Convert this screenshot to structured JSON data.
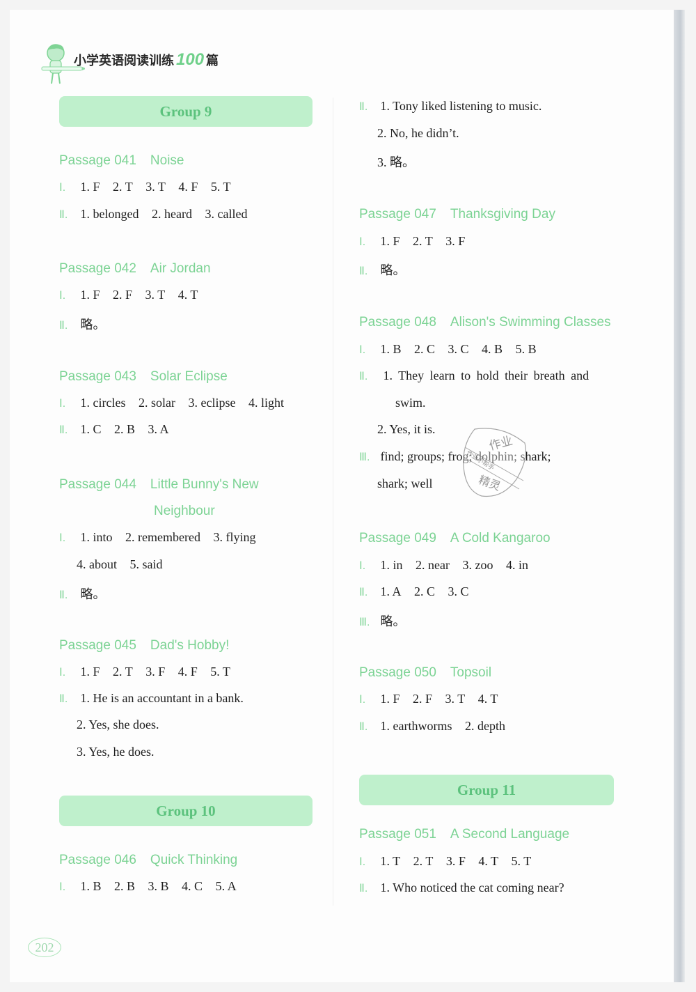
{
  "header": {
    "title_cn": "小学英语阅读训练",
    "title_num": "100",
    "title_suffix": "篇"
  },
  "page_number": "202",
  "stamp_text": {
    "main_top": "作业",
    "main_bottom": "精灵",
    "side": "作业小帮手"
  },
  "left_column": {
    "group_9": "Group 9",
    "p041": {
      "num": "Passage 041",
      "name": "Noise",
      "I": {
        "label": "Ⅰ.",
        "answers": [
          "1. F",
          "2. T",
          "3. T",
          "4. F",
          "5. T"
        ]
      },
      "II": {
        "label": "Ⅱ.",
        "answers": [
          "1. belonged",
          "2. heard",
          "3. called"
        ]
      }
    },
    "p042": {
      "num": "Passage 042",
      "name": "Air Jordan",
      "I": {
        "label": "Ⅰ.",
        "answers": [
          "1. F",
          "2. F",
          "3. T",
          "4. T"
        ]
      },
      "II": {
        "label": "Ⅱ.",
        "text": "略。"
      }
    },
    "p043": {
      "num": "Passage 043",
      "name": "Solar Eclipse",
      "I": {
        "label": "Ⅰ.",
        "answers": [
          "1. circles",
          "2. solar",
          "3. eclipse",
          "4. light"
        ]
      },
      "II": {
        "label": "Ⅱ.",
        "answers": [
          "1. C",
          "2. B",
          "3. A"
        ]
      }
    },
    "p044": {
      "num": "Passage 044",
      "name_line1": "Little Bunny's New",
      "name_line2": "Neighbour",
      "I": {
        "label": "Ⅰ.",
        "answers_line1": [
          "1. into",
          "2. remembered",
          "3. flying"
        ],
        "answers_line2": [
          "4. about",
          "5. said"
        ]
      },
      "II": {
        "label": "Ⅱ.",
        "text": "略。"
      }
    },
    "p045": {
      "num": "Passage 045",
      "name": "Dad's Hobby!",
      "I": {
        "label": "Ⅰ.",
        "answers": [
          "1. F",
          "2. T",
          "3. F",
          "4. F",
          "5. T"
        ]
      },
      "II": {
        "label": "Ⅱ.",
        "lines": [
          "1. He is an accountant in a bank.",
          "2. Yes, she does.",
          "3. Yes, he does."
        ]
      }
    },
    "group_10": "Group 10",
    "p046": {
      "num": "Passage 046",
      "name": "Quick Thinking",
      "I": {
        "label": "Ⅰ.",
        "answers": [
          "1. B",
          "2. B",
          "3. B",
          "4. C",
          "5. A"
        ]
      }
    }
  },
  "right_column": {
    "p046_cont": {
      "II": {
        "label": "Ⅱ.",
        "lines": [
          "1. Tony liked listening to music.",
          "2. No, he didn’t.",
          "3. 略。"
        ]
      }
    },
    "p047": {
      "num": "Passage 047",
      "name": "Thanksgiving Day",
      "I": {
        "label": "Ⅰ.",
        "answers": [
          "1. F",
          "2. T",
          "3. F"
        ]
      },
      "II": {
        "label": "Ⅱ.",
        "text": "略。"
      }
    },
    "p048": {
      "num": "Passage 048",
      "name": "Alison's Swimming Classes",
      "I": {
        "label": "Ⅰ.",
        "answers": [
          "1. B",
          "2. C",
          "3. C",
          "4. B",
          "5. B"
        ]
      },
      "II": {
        "label": "Ⅱ.",
        "lines": [
          "1. They learn to hold their breath and",
          "swim.",
          "2. Yes, it is."
        ]
      },
      "III": {
        "label": "Ⅲ.",
        "line1": "find; groups; frog; dolphin; shark;",
        "line2": "shark; well"
      }
    },
    "p049": {
      "num": "Passage 049",
      "name": "A Cold Kangaroo",
      "I": {
        "label": "Ⅰ.",
        "answers": [
          "1. in",
          "2. near",
          "3. zoo",
          "4. in"
        ]
      },
      "II": {
        "label": "Ⅱ.",
        "answers": [
          "1. A",
          "2. C",
          "3. C"
        ]
      },
      "III": {
        "label": "Ⅲ.",
        "text": "略。"
      }
    },
    "p050": {
      "num": "Passage 050",
      "name": "Topsoil",
      "I": {
        "label": "Ⅰ.",
        "answers": [
          "1. F",
          "2. F",
          "3. T",
          "4. T"
        ]
      },
      "II": {
        "label": "Ⅱ.",
        "answers": [
          "1. earthworms",
          "2. depth"
        ]
      }
    },
    "group_11": "Group 11",
    "p051": {
      "num": "Passage 051",
      "name": "A Second Language",
      "I": {
        "label": "Ⅰ.",
        "answers": [
          "1. T",
          "2. T",
          "3. F",
          "4. T",
          "5. T"
        ]
      },
      "II": {
        "label": "Ⅱ.",
        "lines": [
          "1. Who noticed the cat coming near?"
        ]
      }
    }
  }
}
